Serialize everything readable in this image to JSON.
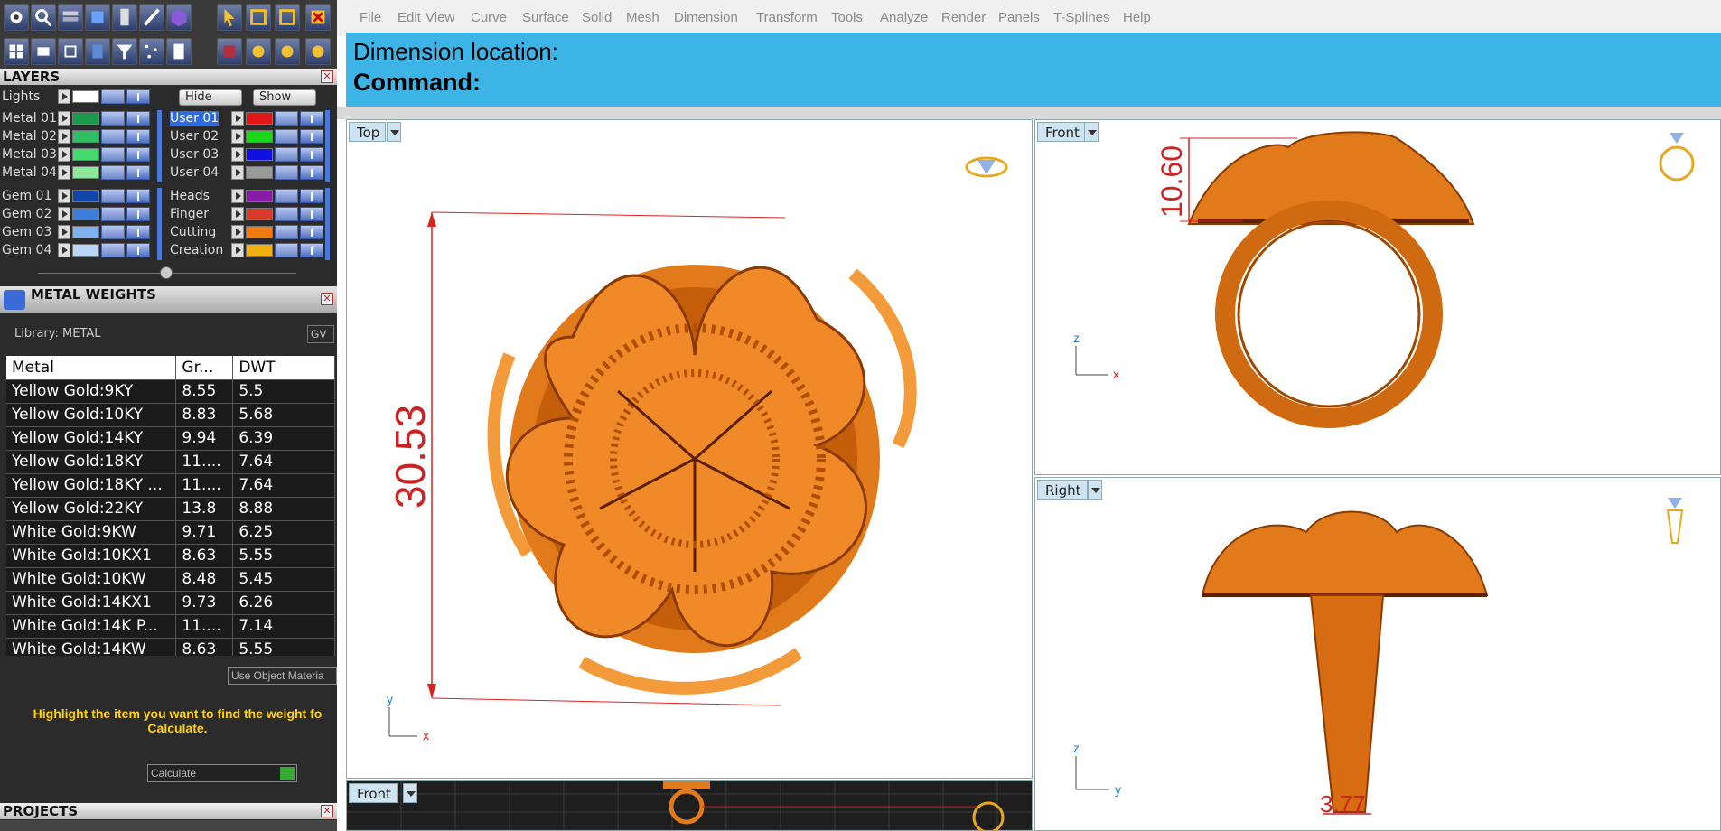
{
  "menu": [
    "File",
    "Edit",
    "View",
    "Curve",
    "Surface",
    "Solid",
    "Mesh",
    "Dimension",
    "Transform",
    "Tools",
    "Analyze",
    "Render",
    "Panels",
    "T-Splines",
    "Help"
  ],
  "command": {
    "line1": "Dimension location:",
    "line2": "Command:"
  },
  "layers": {
    "title": "LAYERS",
    "lights": "Lights",
    "hide": "Hide",
    "show": "Show",
    "left": [
      {
        "name": "Metal 01",
        "color": "#1a9a4a"
      },
      {
        "name": "Metal 02",
        "color": "#2fbf63"
      },
      {
        "name": "Metal 03",
        "color": "#44d86f"
      },
      {
        "name": "Metal 04",
        "color": "#8ee89a"
      },
      {
        "name": "Gem 01",
        "color": "#1046a8"
      },
      {
        "name": "Gem 02",
        "color": "#3c7fd8"
      },
      {
        "name": "Gem 03",
        "color": "#7fb2ee"
      },
      {
        "name": "Gem 04",
        "color": "#b8d6f7"
      }
    ],
    "right": [
      {
        "name": "User 01",
        "color": "#e01818",
        "selected": true
      },
      {
        "name": "User 02",
        "color": "#18d818"
      },
      {
        "name": "User 03",
        "color": "#1010e0"
      },
      {
        "name": "User 04",
        "color": "#9a9a9a"
      },
      {
        "name": "Heads",
        "color": "#8a1aa8"
      },
      {
        "name": "Finger",
        "color": "#d83a2a"
      },
      {
        "name": "Cutting",
        "color": "#f07a10"
      },
      {
        "name": "Creation",
        "color": "#f0b010"
      }
    ]
  },
  "metal_weights": {
    "title": "METAL WEIGHTS",
    "library": "Library: METAL",
    "unit_btn": "GV",
    "columns": [
      "Metal",
      "Gr...",
      "DWT"
    ],
    "rows": [
      [
        "Yellow Gold:9KY",
        "8.55",
        "5.5"
      ],
      [
        "Yellow Gold:10KY",
        "8.83",
        "5.68"
      ],
      [
        "Yellow Gold:14KY",
        "9.94",
        "6.39"
      ],
      [
        "Yellow Gold:18KY",
        "11....",
        "7.64"
      ],
      [
        "Yellow Gold:18KY ...",
        "11....",
        "7.64"
      ],
      [
        "Yellow Gold:22KY",
        "13.8",
        "8.88"
      ],
      [
        "White Gold:9KW",
        "9.71",
        "6.25"
      ],
      [
        "White Gold:10KX1",
        "8.63",
        "5.55"
      ],
      [
        "White Gold:10KW",
        "8.48",
        "5.45"
      ],
      [
        "White Gold:14KX1",
        "9.73",
        "6.26"
      ],
      [
        "White Gold:14K P...",
        "11....",
        "7.14"
      ],
      [
        "White Gold:14KW",
        "8.63",
        "5.55"
      ]
    ],
    "use_object": "Use Object Materia",
    "hint": "Highlight the item you want to find the weight fo Calculate.",
    "calculate": "Calculate"
  },
  "projects": {
    "title": "PROJECTS"
  },
  "viewports": {
    "top": {
      "label": "Top",
      "dimension": "30.53",
      "axis_v": "y",
      "axis_h": "x"
    },
    "front": {
      "label": "Front",
      "dimension": "10.60",
      "axis_v": "z",
      "axis_h": "x"
    },
    "right": {
      "label": "Right",
      "dimension": "3.77",
      "axis_v": "z",
      "axis_h": "y"
    },
    "front_bottom": {
      "label": "Front"
    }
  }
}
